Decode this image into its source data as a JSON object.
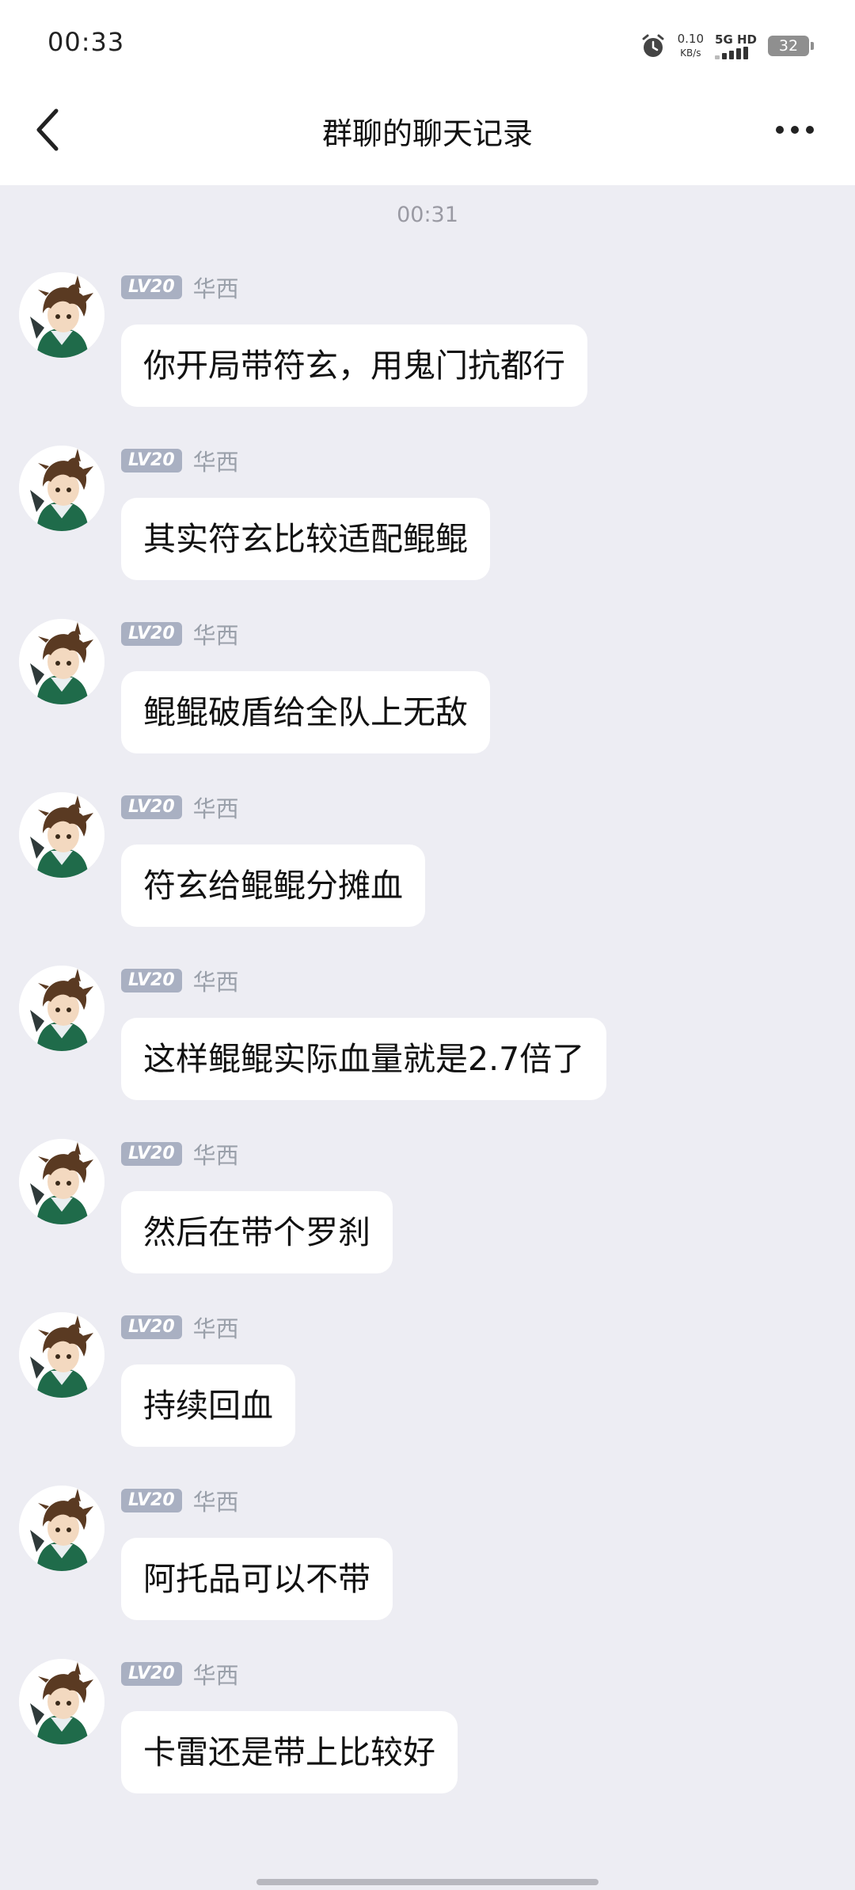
{
  "status_bar": {
    "time": "00:33",
    "net_speed_value": "0.10",
    "net_speed_unit": "KB/s",
    "network_label": "5G HD",
    "battery": "32"
  },
  "header": {
    "title": "群聊的聊天记录",
    "back_icon": "chevron-left-icon",
    "more_icon": "more-horizontal-icon"
  },
  "chat": {
    "timestamp": "00:31",
    "messages": [
      {
        "level": "LV20",
        "sender": "华西",
        "text": "你开局带符玄，用鬼门抗都行"
      },
      {
        "level": "LV20",
        "sender": "华西",
        "text": "其实符玄比较适配鲲鲲"
      },
      {
        "level": "LV20",
        "sender": "华西",
        "text": "鲲鲲破盾给全队上无敌"
      },
      {
        "level": "LV20",
        "sender": "华西",
        "text": "符玄给鲲鲲分摊血"
      },
      {
        "level": "LV20",
        "sender": "华西",
        "text": "这样鲲鲲实际血量就是2.7倍了"
      },
      {
        "level": "LV20",
        "sender": "华西",
        "text": "然后在带个罗刹"
      },
      {
        "level": "LV20",
        "sender": "华西",
        "text": "持续回血"
      },
      {
        "level": "LV20",
        "sender": "华西",
        "text": "阿托品可以不带"
      },
      {
        "level": "LV20",
        "sender": "华西",
        "text": "卡雷还是带上比较好"
      }
    ]
  }
}
